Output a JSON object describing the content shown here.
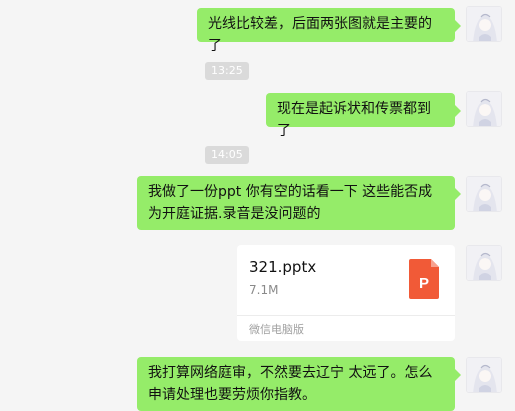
{
  "messages": [
    {
      "id": "m1",
      "text": "光线比较差，后面两张图就是主要的了"
    },
    {
      "id": "m2",
      "text": "现在是起诉状和传票都到了"
    },
    {
      "id": "m3",
      "text": "我做了一份ppt 你有空的话看一下 这些能否成为开庭证据.录音是没问题的"
    },
    {
      "id": "m5",
      "text": "我打算网络庭审，不然要去辽宁 太远了。怎么申请处理也要劳烦你指教。"
    }
  ],
  "timestamps": {
    "t1": "13:25",
    "t2": "14:05"
  },
  "file": {
    "name": "321.pptx",
    "size": "7.1M",
    "source": "微信电脑版",
    "icon_letter": "P",
    "icon_color": "#f15a37"
  },
  "colors": {
    "background": "#f5f5f5",
    "sent_bubble": "#95ec69",
    "time_badge": "#dadada"
  },
  "icons": {
    "avatar": "avatar-anime-girl-icon",
    "file": "ppt-file-icon"
  }
}
